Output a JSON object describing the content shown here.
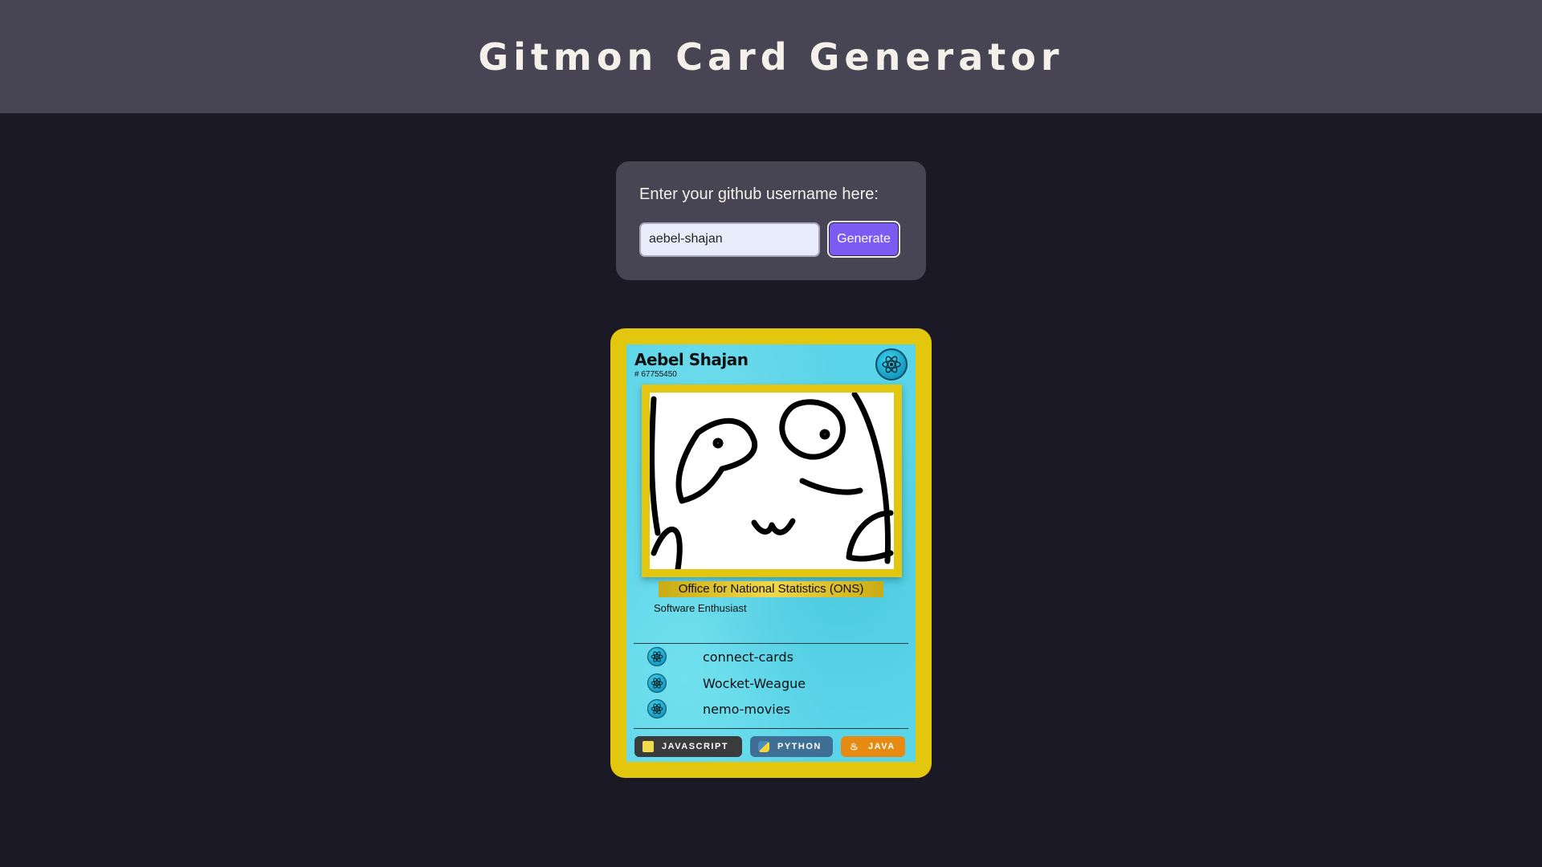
{
  "header": {
    "title": "Gitmon Card Generator"
  },
  "form": {
    "label": "Enter your github username here:",
    "username_value": "aebel-shajan",
    "button_label": "Generate"
  },
  "card": {
    "name": "Aebel Shajan",
    "id": "# 67755450",
    "type_icon": "react-atom-icon",
    "organization": "Office for National Statistics (ONS)",
    "bio": "Software Enthusiast",
    "repos": [
      {
        "name": "connect-cards",
        "icon": "react-atom-icon"
      },
      {
        "name": "Wocket-Weague",
        "icon": "react-atom-icon"
      },
      {
        "name": "nemo-movies",
        "icon": "react-atom-icon"
      }
    ],
    "languages": [
      {
        "name": "JAVASCRIPT",
        "icon": "js-icon",
        "color": "#3a3b3c"
      },
      {
        "name": "PYTHON",
        "icon": "python-icon",
        "color": "#3f6f95"
      },
      {
        "name": "JAVA",
        "icon": "java-icon",
        "color": "#e78a12"
      }
    ]
  },
  "colors": {
    "background": "#1c1926",
    "header": "#474453",
    "accent": "#7b5cf2",
    "card_border": "#e3c70f",
    "card_body": "#5ad4e8"
  }
}
